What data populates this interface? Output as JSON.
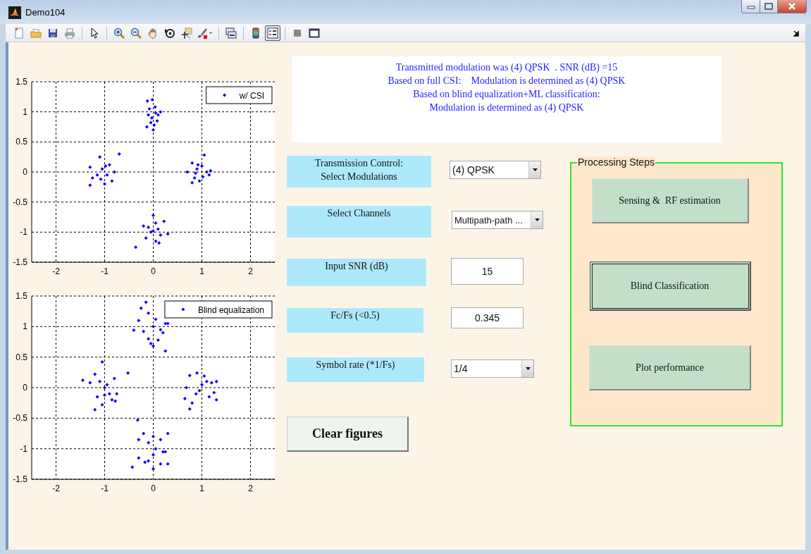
{
  "window": {
    "title": "Demo104"
  },
  "toolbar": [
    {
      "kind": "new",
      "selected": false
    },
    {
      "kind": "open",
      "selected": false
    },
    {
      "kind": "save",
      "selected": false
    },
    {
      "kind": "print",
      "selected": false
    },
    {
      "kind": "pointer",
      "selected": false
    },
    {
      "kind": "zoom-in",
      "selected": false
    },
    {
      "kind": "zoom-out",
      "selected": false
    },
    {
      "kind": "pan",
      "selected": false
    },
    {
      "kind": "rotate",
      "selected": false
    },
    {
      "kind": "data-cursor",
      "selected": false
    },
    {
      "kind": "brush",
      "selected": false
    },
    {
      "kind": "link",
      "selected": false
    },
    {
      "kind": "colorbar",
      "selected": false
    },
    {
      "kind": "legend",
      "selected": true
    },
    {
      "kind": "hide-tools",
      "selected": false
    },
    {
      "kind": "show-tools",
      "selected": false
    }
  ],
  "plots": [
    {
      "chart_data": {
        "type": "scatter",
        "grid": true,
        "xlim": [
          -2.5,
          2.5
        ],
        "ylim": [
          -1.5,
          1.5
        ],
        "xticks": [
          -2,
          -1,
          0,
          1,
          2
        ],
        "yticks": [
          -1.5,
          -1,
          -0.5,
          0,
          0.5,
          1,
          1.5
        ],
        "x": [
          -0.12,
          -0.02,
          -0.08,
          0.05,
          -0.03,
          0.1,
          0.15,
          -0.05,
          0.02,
          -0.13,
          0,
          0.08,
          -0.1,
          0.04,
          -1.3,
          -1.25,
          -1.1,
          -1.05,
          -0.95,
          -0.9,
          -0.85,
          -1.0,
          -1.15,
          -0.8,
          -0.7,
          -1.3,
          -0.98,
          -1.08,
          0.7,
          0.8,
          0.85,
          0.9,
          0.95,
          1.0,
          1.05,
          1.1,
          1.15,
          0.8,
          0.92,
          1.02,
          1.18,
          0.87,
          -0.1,
          0,
          0.05,
          0.1,
          -0.05,
          0.15,
          -0.2,
          0.22,
          0.3,
          0.05,
          -0.15,
          -0.36,
          0.12,
          0.0
        ],
        "series": [
          {
            "name": "w/ CSI",
            "color": "#0000ff",
            "values": [
              1.18,
              1.2,
              1.05,
              0.98,
              0.9,
              0.95,
              1.0,
              0.82,
              0.78,
              0.75,
              0.7,
              0.85,
              0.95,
              1.08,
              0.08,
              -0.1,
              0.25,
              0.05,
              -0.05,
              0.12,
              -0.15,
              -0.2,
              -0.05,
              0.0,
              0.3,
              -0.22,
              0.1,
              -0.12,
              0.0,
              0.15,
              -0.1,
              0.05,
              -0.15,
              0.1,
              0.28,
              0.0,
              -0.05,
              -0.18,
              0.12,
              -0.08,
              0.02,
              -0.02,
              -0.92,
              -0.72,
              -0.85,
              -0.95,
              -1.0,
              -1.05,
              -0.9,
              -0.82,
              -1.03,
              -1.15,
              -1.1,
              -1.25,
              -1.18,
              -0.98
            ]
          }
        ]
      }
    },
    {
      "chart_data": {
        "type": "scatter",
        "grid": true,
        "xlim": [
          -2.5,
          2.5
        ],
        "ylim": [
          -1.5,
          1.5
        ],
        "xticks": [
          -2,
          -1,
          0,
          1,
          2
        ],
        "yticks": [
          -1.5,
          -1,
          -0.5,
          0,
          0.5,
          1,
          1.5
        ],
        "x": [
          -0.15,
          -0.25,
          -0.1,
          0.05,
          0.0,
          -0.3,
          -0.2,
          0.25,
          0.3,
          0.2,
          -0.1,
          0.0,
          0.1,
          -0.4,
          0.25,
          -0.05,
          0.15,
          -1.45,
          -1.2,
          -1.05,
          -1.1,
          -1.0,
          -0.9,
          -0.8,
          -0.85,
          -1.2,
          -1.05,
          -0.75,
          -0.52,
          -1.3,
          -0.95,
          -1.15,
          -0.78,
          -1.0,
          0.68,
          0.75,
          0.9,
          1.0,
          0.95,
          1.1,
          1.2,
          1.3,
          1.3,
          1.15,
          0.75,
          0.8,
          0.65,
          0.88,
          1.05,
          1.25,
          -0.32,
          -0.2,
          -0.3,
          -0.1,
          0.0,
          0.15,
          0.3,
          0.25,
          0.2,
          0.0,
          -0.1,
          -0.3,
          -0.43,
          0.0,
          0.15,
          0.3,
          -0.17,
          0.05
        ],
        "series": [
          {
            "name": "Blind equalization",
            "color": "#0000ff",
            "values": [
              1.4,
              1.3,
              1.22,
              1.12,
              1.0,
              1.1,
              0.92,
              1.05,
              1.05,
              0.9,
              0.8,
              0.68,
              0.78,
              0.94,
              0.6,
              0.72,
              0.95,
              0.12,
              0.22,
              0.42,
              0.1,
              0.0,
              -0.1,
              0.15,
              -0.2,
              -0.36,
              -0.28,
              -0.1,
              0.24,
              0.08,
              0.05,
              -0.15,
              -0.22,
              -0.12,
              0.0,
              0.2,
              0.24,
              0.05,
              -0.05,
              0.1,
              0.08,
              0.1,
              -0.2,
              -0.15,
              -0.35,
              -0.25,
              -0.18,
              -0.1,
              0.19,
              -0.08,
              -0.53,
              -0.75,
              -0.85,
              -0.9,
              -0.8,
              -0.85,
              -0.75,
              -1.05,
              -1.05,
              -1.1,
              -1.2,
              -1.15,
              -1.3,
              -1.33,
              -1.25,
              -1.25,
              -1.22,
              -1.0
            ]
          }
        ]
      }
    }
  ],
  "result_lines": [
    "Transmitted modulation was (4) QPSK  . SNR (dB) =15",
    "Based on full CSI:    Modulation is determined as (4) QPSK",
    "Based on blind equalization+ML classification:",
    "Modulation is determined as (4) QPSK"
  ],
  "controls": [
    {
      "label": "Transmission Control:\nSelect Modulations",
      "kind": "dropdown",
      "value": "(4) QPSK"
    },
    {
      "label": "Select Channels",
      "kind": "dropdown",
      "value": "Multipath-path ..."
    },
    {
      "label": "Input SNR (dB)",
      "kind": "field",
      "value": "15"
    },
    {
      "label": "Fc/Fs   (<0.5)",
      "kind": "field",
      "value": "0.345"
    },
    {
      "label": "Symbol rate (*1/Fs)",
      "kind": "dropdown",
      "value": "1/4"
    }
  ],
  "clear_button": "Clear figures",
  "processing": {
    "title": "Processing Steps",
    "buttons": [
      {
        "label": "Sensing &  RF estimation",
        "focused": false
      },
      {
        "label": "Blind Classification",
        "focused": true
      },
      {
        "label": "Plot performance",
        "focused": false
      }
    ]
  }
}
